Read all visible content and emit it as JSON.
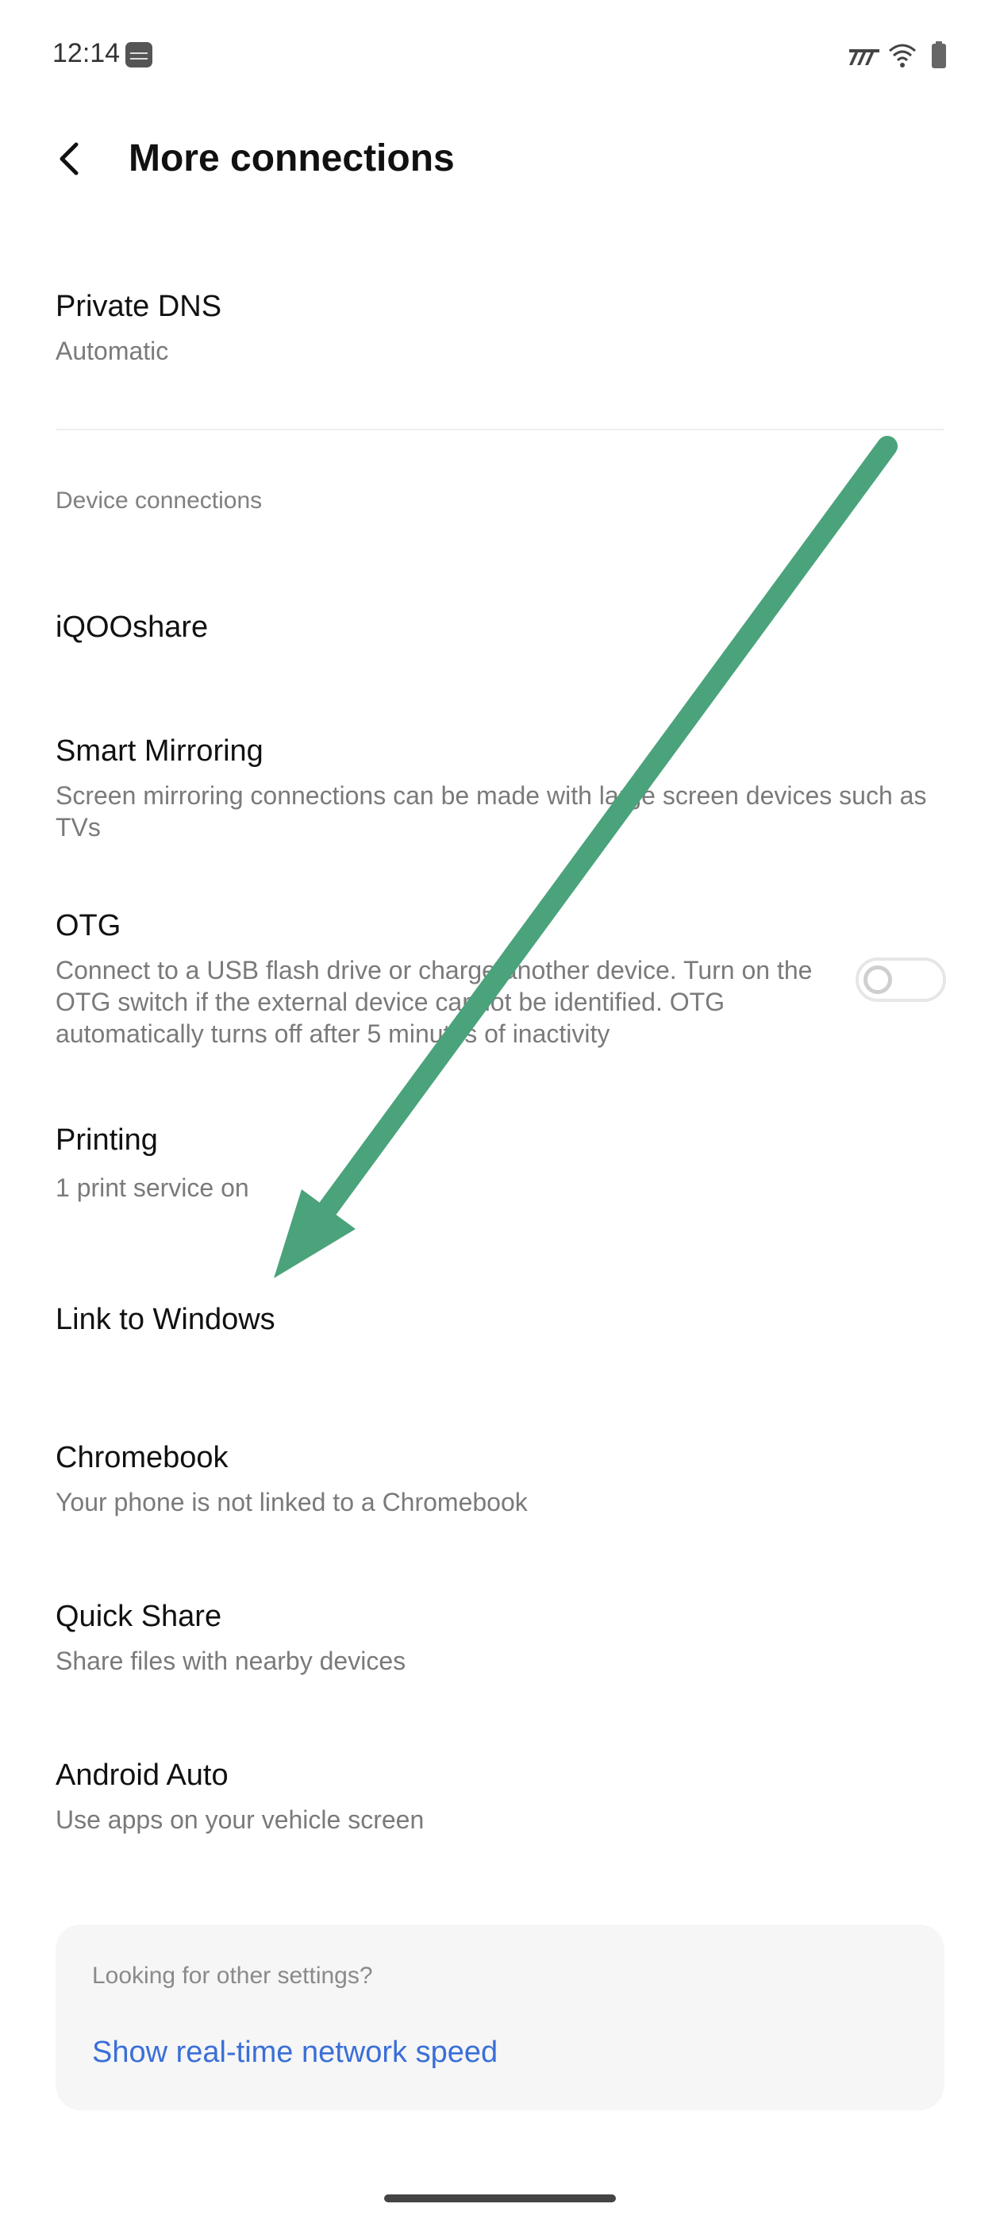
{
  "status_bar": {
    "time": "12:14"
  },
  "header": {
    "title": "More connections"
  },
  "items": {
    "private_dns": {
      "title": "Private DNS",
      "subtitle": "Automatic"
    },
    "section_device": "Device connections",
    "iqooshare": {
      "title": "iQOOshare"
    },
    "smart_mirroring": {
      "title": "Smart Mirroring",
      "subtitle": "Screen mirroring connections can be made with large screen devices such as TVs"
    },
    "otg": {
      "title": "OTG",
      "subtitle": "Connect to a USB flash drive or charge another device. Turn on the OTG switch if the external device cannot be identified. OTG automatically turns off after 5 minutes of inactivity",
      "enabled": false
    },
    "printing": {
      "title": "Printing",
      "subtitle": "1 print service on"
    },
    "link_to_windows": {
      "title": "Link to Windows"
    },
    "chromebook": {
      "title": "Chromebook",
      "subtitle": "Your phone is not linked to a Chromebook"
    },
    "quick_share": {
      "title": "Quick Share",
      "subtitle": "Share files with nearby devices"
    },
    "android_auto": {
      "title": "Android Auto",
      "subtitle": "Use apps on your vehicle screen"
    }
  },
  "card": {
    "label": "Looking for other settings?",
    "link": "Show real-time network speed"
  },
  "colors": {
    "link": "#3a6fd8",
    "annotation_arrow": "#4aa37b"
  }
}
